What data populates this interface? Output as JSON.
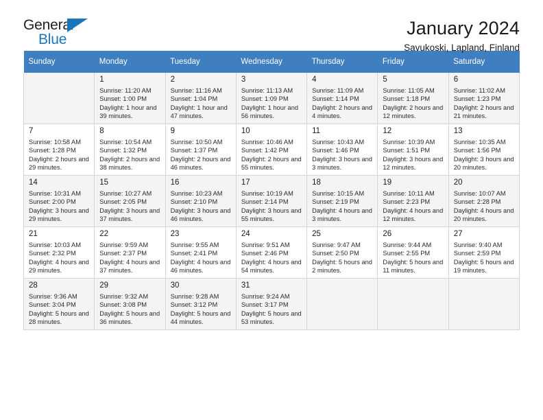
{
  "brand": {
    "name_top": "General",
    "name_bottom": "Blue",
    "accent_color": "#1b75bb"
  },
  "header": {
    "title": "January 2024",
    "subtitle": "Savukoski, Lapland, Finland"
  },
  "calendar": {
    "header_bg": "#3f7fbf",
    "shaded_row_bg": "#f4f4f4",
    "weekdays": [
      "Sunday",
      "Monday",
      "Tuesday",
      "Wednesday",
      "Thursday",
      "Friday",
      "Saturday"
    ],
    "weeks": [
      [
        {
          "day": "",
          "sunrise": "",
          "sunset": "",
          "daylight": "",
          "empty": true
        },
        {
          "day": "1",
          "sunrise": "Sunrise: 11:20 AM",
          "sunset": "Sunset: 1:00 PM",
          "daylight": "Daylight: 1 hour and 39 minutes."
        },
        {
          "day": "2",
          "sunrise": "Sunrise: 11:16 AM",
          "sunset": "Sunset: 1:04 PM",
          "daylight": "Daylight: 1 hour and 47 minutes."
        },
        {
          "day": "3",
          "sunrise": "Sunrise: 11:13 AM",
          "sunset": "Sunset: 1:09 PM",
          "daylight": "Daylight: 1 hour and 56 minutes."
        },
        {
          "day": "4",
          "sunrise": "Sunrise: 11:09 AM",
          "sunset": "Sunset: 1:14 PM",
          "daylight": "Daylight: 2 hours and 4 minutes."
        },
        {
          "day": "5",
          "sunrise": "Sunrise: 11:05 AM",
          "sunset": "Sunset: 1:18 PM",
          "daylight": "Daylight: 2 hours and 12 minutes."
        },
        {
          "day": "6",
          "sunrise": "Sunrise: 11:02 AM",
          "sunset": "Sunset: 1:23 PM",
          "daylight": "Daylight: 2 hours and 21 minutes."
        }
      ],
      [
        {
          "day": "7",
          "sunrise": "Sunrise: 10:58 AM",
          "sunset": "Sunset: 1:28 PM",
          "daylight": "Daylight: 2 hours and 29 minutes."
        },
        {
          "day": "8",
          "sunrise": "Sunrise: 10:54 AM",
          "sunset": "Sunset: 1:32 PM",
          "daylight": "Daylight: 2 hours and 38 minutes."
        },
        {
          "day": "9",
          "sunrise": "Sunrise: 10:50 AM",
          "sunset": "Sunset: 1:37 PM",
          "daylight": "Daylight: 2 hours and 46 minutes."
        },
        {
          "day": "10",
          "sunrise": "Sunrise: 10:46 AM",
          "sunset": "Sunset: 1:42 PM",
          "daylight": "Daylight: 2 hours and 55 minutes."
        },
        {
          "day": "11",
          "sunrise": "Sunrise: 10:43 AM",
          "sunset": "Sunset: 1:46 PM",
          "daylight": "Daylight: 3 hours and 3 minutes."
        },
        {
          "day": "12",
          "sunrise": "Sunrise: 10:39 AM",
          "sunset": "Sunset: 1:51 PM",
          "daylight": "Daylight: 3 hours and 12 minutes."
        },
        {
          "day": "13",
          "sunrise": "Sunrise: 10:35 AM",
          "sunset": "Sunset: 1:56 PM",
          "daylight": "Daylight: 3 hours and 20 minutes."
        }
      ],
      [
        {
          "day": "14",
          "sunrise": "Sunrise: 10:31 AM",
          "sunset": "Sunset: 2:00 PM",
          "daylight": "Daylight: 3 hours and 29 minutes."
        },
        {
          "day": "15",
          "sunrise": "Sunrise: 10:27 AM",
          "sunset": "Sunset: 2:05 PM",
          "daylight": "Daylight: 3 hours and 37 minutes."
        },
        {
          "day": "16",
          "sunrise": "Sunrise: 10:23 AM",
          "sunset": "Sunset: 2:10 PM",
          "daylight": "Daylight: 3 hours and 46 minutes."
        },
        {
          "day": "17",
          "sunrise": "Sunrise: 10:19 AM",
          "sunset": "Sunset: 2:14 PM",
          "daylight": "Daylight: 3 hours and 55 minutes."
        },
        {
          "day": "18",
          "sunrise": "Sunrise: 10:15 AM",
          "sunset": "Sunset: 2:19 PM",
          "daylight": "Daylight: 4 hours and 3 minutes."
        },
        {
          "day": "19",
          "sunrise": "Sunrise: 10:11 AM",
          "sunset": "Sunset: 2:23 PM",
          "daylight": "Daylight: 4 hours and 12 minutes."
        },
        {
          "day": "20",
          "sunrise": "Sunrise: 10:07 AM",
          "sunset": "Sunset: 2:28 PM",
          "daylight": "Daylight: 4 hours and 20 minutes."
        }
      ],
      [
        {
          "day": "21",
          "sunrise": "Sunrise: 10:03 AM",
          "sunset": "Sunset: 2:32 PM",
          "daylight": "Daylight: 4 hours and 29 minutes."
        },
        {
          "day": "22",
          "sunrise": "Sunrise: 9:59 AM",
          "sunset": "Sunset: 2:37 PM",
          "daylight": "Daylight: 4 hours and 37 minutes."
        },
        {
          "day": "23",
          "sunrise": "Sunrise: 9:55 AM",
          "sunset": "Sunset: 2:41 PM",
          "daylight": "Daylight: 4 hours and 46 minutes."
        },
        {
          "day": "24",
          "sunrise": "Sunrise: 9:51 AM",
          "sunset": "Sunset: 2:46 PM",
          "daylight": "Daylight: 4 hours and 54 minutes."
        },
        {
          "day": "25",
          "sunrise": "Sunrise: 9:47 AM",
          "sunset": "Sunset: 2:50 PM",
          "daylight": "Daylight: 5 hours and 2 minutes."
        },
        {
          "day": "26",
          "sunrise": "Sunrise: 9:44 AM",
          "sunset": "Sunset: 2:55 PM",
          "daylight": "Daylight: 5 hours and 11 minutes."
        },
        {
          "day": "27",
          "sunrise": "Sunrise: 9:40 AM",
          "sunset": "Sunset: 2:59 PM",
          "daylight": "Daylight: 5 hours and 19 minutes."
        }
      ],
      [
        {
          "day": "28",
          "sunrise": "Sunrise: 9:36 AM",
          "sunset": "Sunset: 3:04 PM",
          "daylight": "Daylight: 5 hours and 28 minutes."
        },
        {
          "day": "29",
          "sunrise": "Sunrise: 9:32 AM",
          "sunset": "Sunset: 3:08 PM",
          "daylight": "Daylight: 5 hours and 36 minutes."
        },
        {
          "day": "30",
          "sunrise": "Sunrise: 9:28 AM",
          "sunset": "Sunset: 3:12 PM",
          "daylight": "Daylight: 5 hours and 44 minutes."
        },
        {
          "day": "31",
          "sunrise": "Sunrise: 9:24 AM",
          "sunset": "Sunset: 3:17 PM",
          "daylight": "Daylight: 5 hours and 53 minutes."
        },
        {
          "day": "",
          "sunrise": "",
          "sunset": "",
          "daylight": "",
          "empty": true
        },
        {
          "day": "",
          "sunrise": "",
          "sunset": "",
          "daylight": "",
          "empty": true
        },
        {
          "day": "",
          "sunrise": "",
          "sunset": "",
          "daylight": "",
          "empty": true
        }
      ]
    ]
  }
}
